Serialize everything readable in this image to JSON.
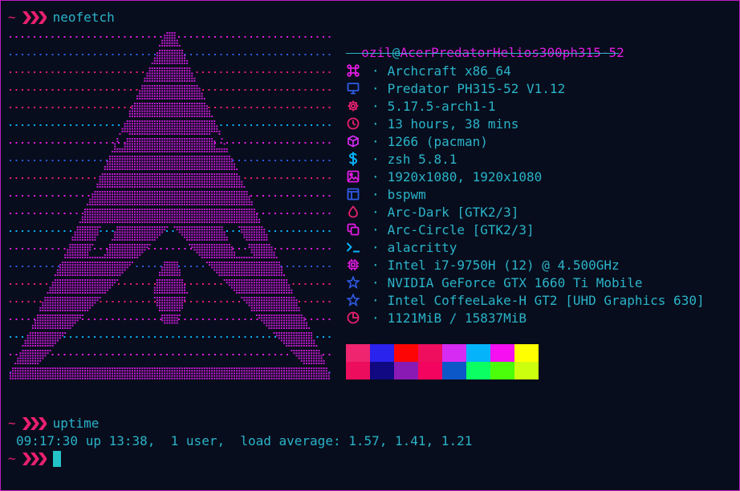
{
  "colors": {
    "background": "#070d1c",
    "text": "#2bb3c9",
    "accent_magenta": "#e51ce4",
    "prompt_red": "#e8206f",
    "border": "#c01ac5",
    "cursor": "#23c3c8"
  },
  "prompt": {
    "tilde": "~",
    "chevron_icon": "triple-chevron-right-icon"
  },
  "commands": {
    "first": "neofetch",
    "second": "uptime"
  },
  "neofetch": {
    "user": "ozil",
    "at": "@",
    "host": "AcerPredatorHelios300ph315-52",
    "separator_char": "·",
    "info": [
      {
        "icon": "command-key-icon",
        "value": "Archcraft x86_64"
      },
      {
        "icon": "monitor-icon",
        "value": "Predator PH315-52 V1.12"
      },
      {
        "icon": "gear-icon",
        "value": "5.17.5-arch1-1"
      },
      {
        "icon": "clock-icon",
        "value": "13 hours, 38 mins"
      },
      {
        "icon": "package-icon",
        "value": "1266 (pacman)"
      },
      {
        "icon": "dollar-icon",
        "value": "zsh 5.8.1"
      },
      {
        "icon": "image-icon",
        "value": "1920x1080, 1920x1080"
      },
      {
        "icon": "window-layout-icon",
        "value": "bspwm"
      },
      {
        "icon": "droplet-icon",
        "value": "Arc-Dark [GTK2/3]"
      },
      {
        "icon": "copy-icon",
        "value": "Arc-Circle [GTK2/3]"
      },
      {
        "icon": "terminal-icon",
        "value": "alacritty"
      },
      {
        "icon": "cpu-icon",
        "value": "Intel i7-9750H (12) @ 4.500GHz"
      },
      {
        "icon": "star-icon",
        "value": "NVIDIA GeForce GTX 1660 Ti Mobile"
      },
      {
        "icon": "star-icon",
        "value": "Intel CoffeeLake-H GT2 [UHD Graphics 630]"
      },
      {
        "icon": "pie-chart-icon",
        "value": "1121MiB / 15837MiB"
      }
    ],
    "palette": [
      [
        "#f0256f",
        "#2a22ed",
        "#fd0505",
        "#ef0d5e",
        "#d62bf2",
        "#05b3fb",
        "#f60ff1",
        "#ffff00"
      ],
      [
        "#ec0d5d",
        "#100981",
        "#8a1ab4",
        "#f2045f",
        "#0d58c8",
        "#0cff62",
        "#4bff0a",
        "#cbff0d"
      ]
    ]
  },
  "uptime": {
    "output": "09:17:30 up 13:38,  1 user,  load average: 1.57, 1.41, 1.21"
  }
}
